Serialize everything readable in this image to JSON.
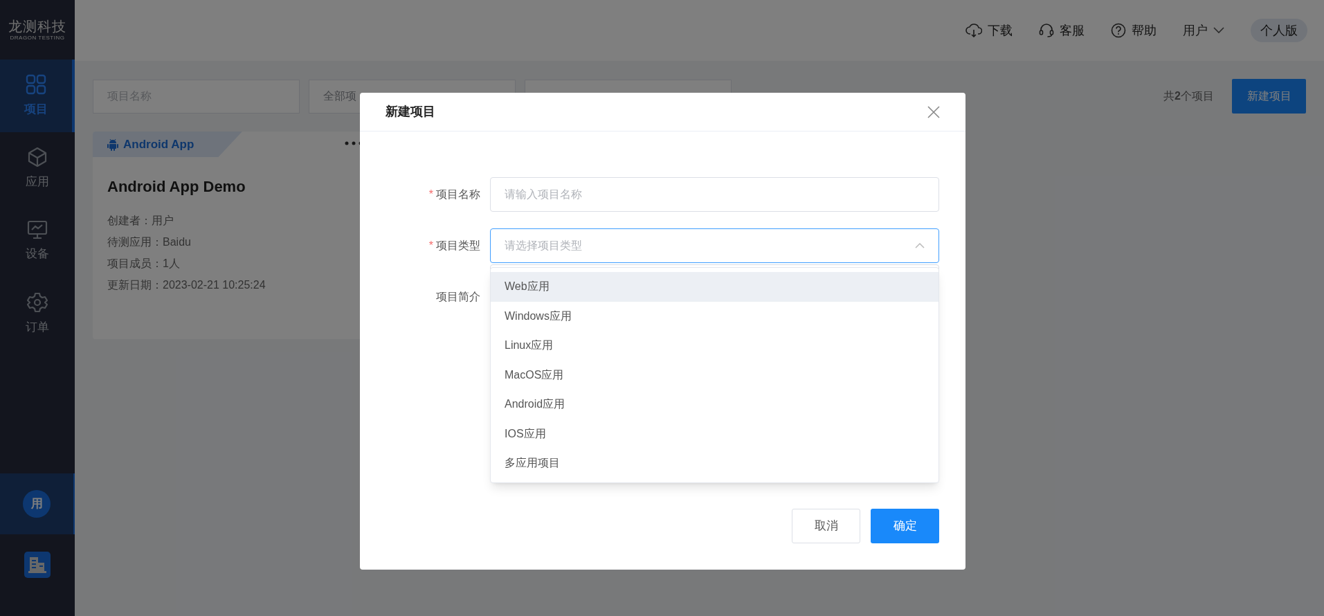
{
  "brand": {
    "name": "龙测科技",
    "tagline": "DRAGON TESTING"
  },
  "sidebar": {
    "items": [
      {
        "kind": "grid",
        "label": "项目",
        "selected": true
      },
      {
        "kind": "cube",
        "label": "应用",
        "selected": false
      },
      {
        "kind": "monitor",
        "label": "设备",
        "selected": false
      },
      {
        "kind": "gear",
        "label": "订单",
        "selected": false
      }
    ],
    "bottom_items": [
      {
        "kind": "avatar",
        "text": "用",
        "selected": true
      },
      {
        "kind": "building",
        "selected": false
      }
    ]
  },
  "header": {
    "links": [
      {
        "kind": "download",
        "label": "下载"
      },
      {
        "kind": "headset",
        "label": "客服"
      },
      {
        "kind": "help",
        "label": "帮助"
      }
    ],
    "user": "用户",
    "edition": "个人版"
  },
  "toolbar": {
    "filters": [
      {
        "placeholder": "项目名称"
      },
      {
        "value": "全部项"
      }
    ],
    "count": "共**2**个项目",
    "new_button": "新建项目"
  },
  "project_card": {
    "tag": "Android App",
    "title": "Android App Demo",
    "details": [
      "创建者：用户",
      "待测应用：Baidu",
      "项目成员：1人",
      "更新日期：2023-02-21 10:25:24"
    ]
  },
  "dialog": {
    "title": "新建项目",
    "fields": [
      {
        "kind": "input",
        "label": "项目名称",
        "required_mark": "*",
        "placeholder": "请输入项目名称"
      },
      {
        "kind": "select",
        "label": "项目类型",
        "required_mark": "*",
        "placeholder": "请选择项目类型",
        "expanded": true
      },
      {
        "kind": "textarea",
        "label": "项目简介"
      }
    ],
    "dropdown": [
      {
        "label": "Web应用",
        "hovered": true
      },
      {
        "label": "Windows应用",
        "hovered": false
      },
      {
        "label": "Linux应用",
        "hovered": false
      },
      {
        "label": "MacOS应用",
        "hovered": false
      },
      {
        "label": "Android应用",
        "hovered": false
      },
      {
        "label": "IOS应用",
        "hovered": false
      },
      {
        "label": "多应用项目",
        "hovered": false
      }
    ],
    "buttons": [
      {
        "kind": "default",
        "label": "取消"
      },
      {
        "kind": "primary",
        "label": "确定"
      }
    ]
  }
}
